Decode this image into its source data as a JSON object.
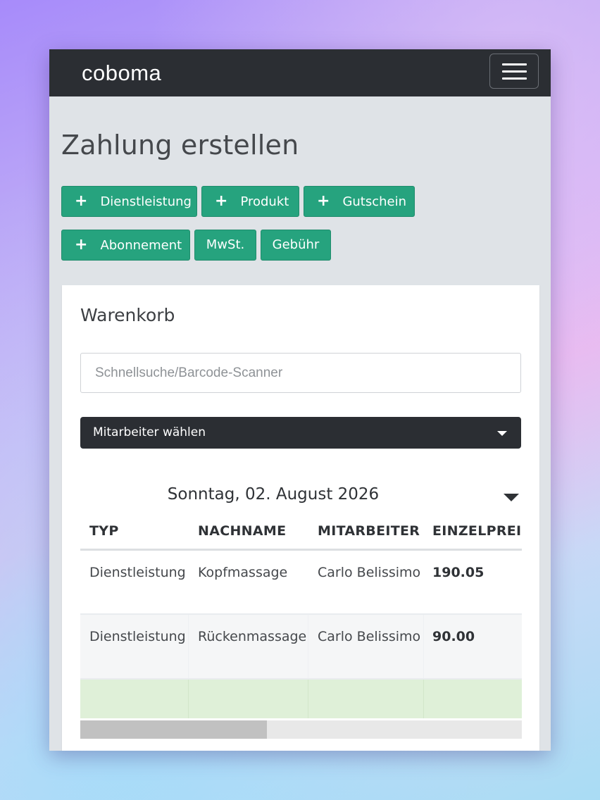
{
  "brand": {
    "logo_text": "coboma"
  },
  "header": {
    "menu_icon": "hamburger-icon"
  },
  "page": {
    "title": "Zahlung erstellen"
  },
  "actions": {
    "dienstleistung": "Dienstleistung",
    "produkt": "Produkt",
    "gutschein": "Gutschein",
    "abonnement": "Abonnement",
    "mwst": "MwSt.",
    "gebuehr": "Gebühr",
    "plus_icon": "plus-icon",
    "accent_color": "#26a37e"
  },
  "cart": {
    "title": "Warenkorb",
    "search_placeholder": "Schnellsuche/Barcode-Scanner",
    "employee_select": "Mitarbeiter wählen",
    "date": "Sonntag, 02. August 2026",
    "columns": [
      "TYP",
      "NACHNAME",
      "MITARBEITER",
      "EINZELPREIS"
    ],
    "rows": [
      {
        "typ": "Dienstleistung",
        "name": "Kopfmassage",
        "mitarbeiter": "Carlo Belissimo",
        "preis": "190.05"
      },
      {
        "typ": "Dienstleistung",
        "name": "Rückenmassage",
        "mitarbeiter": "Carlo Belissimo",
        "preis": "90.00"
      }
    ]
  }
}
